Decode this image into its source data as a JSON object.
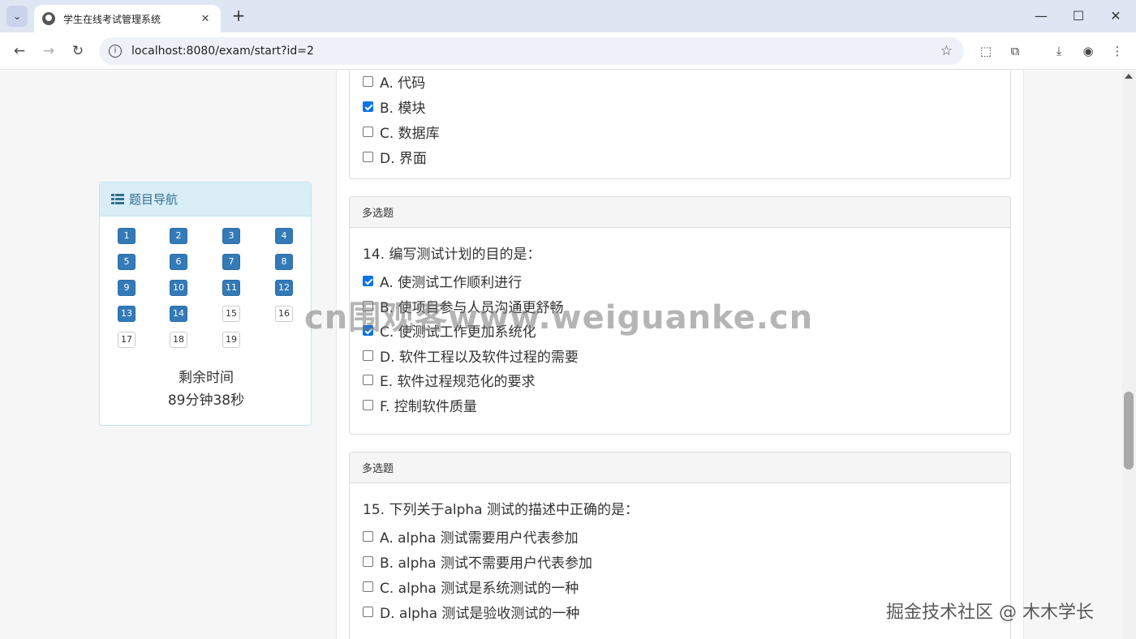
{
  "browser": {
    "tab_title": "学生在线考试管理系统",
    "url": "localhost:8080/exam/start?id=2"
  },
  "navigator": {
    "title": "题目导航",
    "questions": [
      {
        "n": "1",
        "answered": true
      },
      {
        "n": "2",
        "answered": true
      },
      {
        "n": "3",
        "answered": true
      },
      {
        "n": "4",
        "answered": true
      },
      {
        "n": "5",
        "answered": true
      },
      {
        "n": "6",
        "answered": true
      },
      {
        "n": "7",
        "answered": true
      },
      {
        "n": "8",
        "answered": true
      },
      {
        "n": "9",
        "answered": true
      },
      {
        "n": "10",
        "answered": true
      },
      {
        "n": "11",
        "answered": true
      },
      {
        "n": "12",
        "answered": true
      },
      {
        "n": "13",
        "answered": true
      },
      {
        "n": "14",
        "answered": true
      },
      {
        "n": "15",
        "answered": false
      },
      {
        "n": "16",
        "answered": false
      },
      {
        "n": "17",
        "answered": false
      },
      {
        "n": "18",
        "answered": false
      },
      {
        "n": "19",
        "answered": false
      }
    ],
    "timer_label": "剩余时间",
    "timer_value": "89分钟38秒"
  },
  "q13": {
    "options": [
      {
        "label": "A. 代码",
        "checked": false
      },
      {
        "label": "B. 模块",
        "checked": true
      },
      {
        "label": "C. 数据库",
        "checked": false
      },
      {
        "label": "D. 界面",
        "checked": false
      }
    ]
  },
  "q14": {
    "type": "多选题",
    "text": "14. 编写测试计划的目的是：",
    "options": [
      {
        "label": "A. 使测试工作顺利进行",
        "checked": true
      },
      {
        "label": "B. 使项目参与人员沟通更舒畅",
        "checked": false
      },
      {
        "label": "C. 使测试工作更加系统化",
        "checked": true
      },
      {
        "label": "D. 软件工程以及软件过程的需要",
        "checked": false
      },
      {
        "label": "E. 软件过程规范化的要求",
        "checked": false
      },
      {
        "label": "F. 控制软件质量",
        "checked": false
      }
    ]
  },
  "q15": {
    "type": "多选题",
    "text": "15. 下列关于alpha 测试的描述中正确的是：",
    "options": [
      {
        "label": "A. alpha 测试需要用户代表参加",
        "checked": false
      },
      {
        "label": "B. alpha 测试不需要用户代表参加",
        "checked": false
      },
      {
        "label": "C. alpha 测试是系统测试的一种",
        "checked": false
      },
      {
        "label": "D. alpha 测试是验收测试的一种",
        "checked": false
      }
    ]
  },
  "watermarks": {
    "center": "cn围观客www.weiguanke.cn",
    "corner": "掘金技术社区 @ 木木学长"
  }
}
